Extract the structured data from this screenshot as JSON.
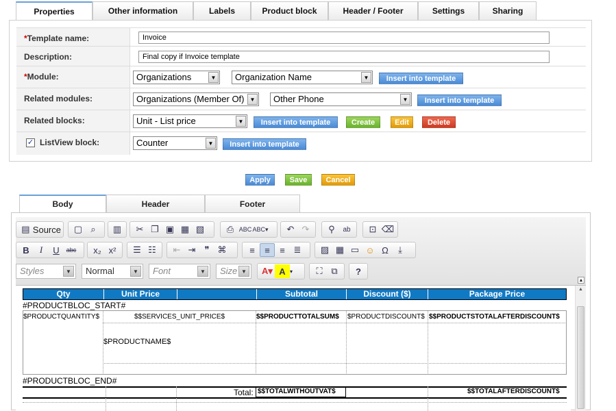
{
  "tabs": [
    "Properties",
    "Other information",
    "Labels",
    "Product block",
    "Header / Footer",
    "Settings",
    "Sharing"
  ],
  "form": {
    "template_name_label": "Template name:",
    "template_name_value": "Invoice",
    "description_label": "Description:",
    "description_value": "Final copy if Invoice template",
    "module_label": "Module:",
    "module_value": "Organizations",
    "module_field_value": "Organization Name",
    "related_modules_label": "Related modules:",
    "related_modules_value": "Organizations (Member Of)",
    "related_field_value": "Other Phone",
    "related_blocks_label": "Related blocks:",
    "related_blocks_value": "Unit - List price",
    "listview_label": "ListView block:",
    "listview_value": "Counter",
    "insert_label": "Insert into template",
    "create_label": "Create",
    "edit_label": "Edit",
    "delete_label": "Delete",
    "required_mark": "*",
    "check_mark": "✓"
  },
  "actions": {
    "apply": "Apply",
    "save": "Save",
    "cancel": "Cancel"
  },
  "editor_tabs": [
    "Body",
    "Header",
    "Footer"
  ],
  "toolbar": {
    "source_label": "Source",
    "styles_placeholder": "Styles",
    "format_value": "Normal",
    "font_placeholder": "Font",
    "size_placeholder": "Size"
  },
  "table": {
    "headers": [
      "Qty",
      "Unit Price",
      "Subtotal",
      "Discount ($)",
      "Package Price"
    ],
    "bloc_start": "#PRODUCTBLOC_START#",
    "qty_var": "$PRODUCTQUANTITY$",
    "unit_price_var": "$$SERVICES_UNIT_PRICE$",
    "subtotal_var": "$$PRODUCTTOTALSUM$",
    "discount_var": "$PRODUCTDISCOUNT$",
    "package_var": "$$PRODUCTSTOTALAFTERDISCOUNT$",
    "name_var": "$PRODUCTNAME$",
    "bloc_end": "#PRODUCTBLOC_END#",
    "total_label": "Total:",
    "total_without_vat": "$$TOTALWITHOUTVAT$",
    "total_after_discount": "$$TOTALAFTERDISCOUNT$"
  },
  "colors": {
    "header_blue": "#1079c4",
    "btn_blue": "#4a8ad6",
    "btn_green": "#6ab22e",
    "btn_orange": "#e39a0a",
    "btn_red": "#cc3a22"
  }
}
